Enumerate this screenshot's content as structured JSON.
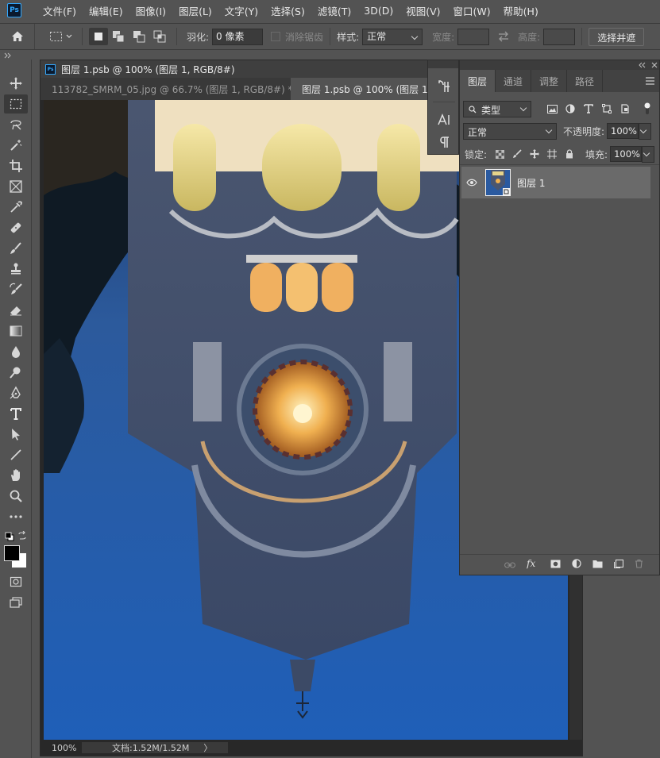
{
  "menu": [
    "文件(F)",
    "编辑(E)",
    "图像(I)",
    "图层(L)",
    "文字(Y)",
    "选择(S)",
    "滤镜(T)",
    "3D(D)",
    "视图(V)",
    "窗口(W)",
    "帮助(H)"
  ],
  "app_logo": "Ps",
  "options": {
    "feather_label": "羽化:",
    "feather_value": "0 像素",
    "antialias_label": "消除锯齿",
    "style_label": "样式:",
    "style_value": "正常",
    "width_label": "宽度:",
    "height_label": "高度:",
    "select_mask_button": "选择并遮"
  },
  "document": {
    "title": "图层 1.psb @ 100% (图层 1, RGB/8#)",
    "tabs": [
      {
        "label": "113782_SMRM_05.jpg @ 66.7% (图层 1, RGB/8#) *",
        "close": "×"
      },
      {
        "label": "图层 1.psb @ 100% (图层 1, R",
        "close": "×"
      }
    ],
    "zoom": "100%",
    "doc_info": "文档:1.52M/1.52M",
    "status_arrow": "〉"
  },
  "layers_panel": {
    "tabs": [
      "图层",
      "通道",
      "调整",
      "路径"
    ],
    "filter_kind": "类型",
    "blend_mode": "正常",
    "opacity_label": "不透明度:",
    "opacity_value": "100%",
    "lock_label": "锁定:",
    "fill_label": "填充:",
    "fill_value": "100%",
    "layer_name": "图层 1"
  },
  "colors": {
    "ps_blue": "#31a8ff",
    "panel_bg": "#535353",
    "canvas_sky": "#2f66ad"
  },
  "icons": {
    "toolbar": [
      "move-icon",
      "marquee-icon",
      "lasso-icon",
      "magic-wand-icon",
      "crop-icon",
      "frame-icon",
      "eyedropper-icon",
      "healing-icon",
      "brush-icon",
      "stamp-icon",
      "history-brush-icon",
      "eraser-icon",
      "gradient-icon",
      "blur-icon",
      "dodge-icon",
      "pen-icon",
      "type-icon",
      "path-select-icon",
      "line-icon",
      "hand-icon",
      "zoom-icon",
      "more-icon"
    ]
  }
}
